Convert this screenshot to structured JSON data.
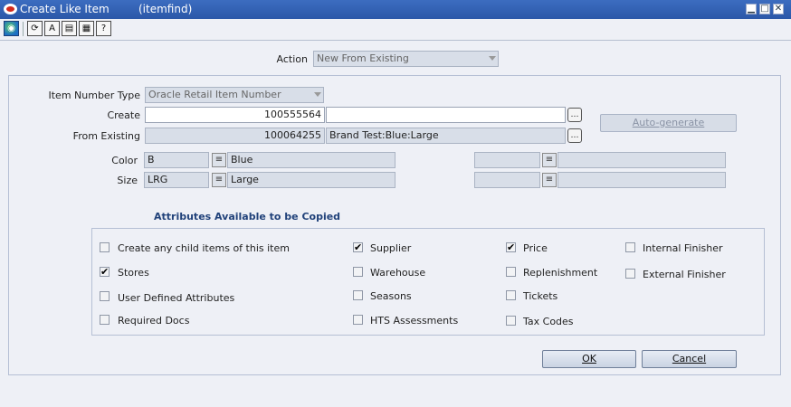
{
  "window": {
    "title": "Create Like Item",
    "subtitle": "(itemfind)",
    "minimize_icon": "▁",
    "maximize_icon": "□",
    "close_icon": "✕"
  },
  "toolbar": {
    "buttons": [
      {
        "name": "globe-icon",
        "glyph": "◉"
      },
      {
        "name": "save-icon",
        "glyph": "⟳"
      },
      {
        "name": "spellcheck-icon",
        "glyph": "A"
      },
      {
        "name": "notes-icon",
        "glyph": "▤"
      },
      {
        "name": "print-icon",
        "glyph": "▦"
      },
      {
        "name": "help-icon",
        "glyph": "?"
      }
    ]
  },
  "action": {
    "label": "Action",
    "value": "New From Existing"
  },
  "form": {
    "item_number_type_label": "Item Number Type",
    "item_number_type_value": "Oracle Retail Item Number",
    "create_label": "Create",
    "create_value": "100555564",
    "create_desc": "",
    "from_existing_label": "From Existing",
    "from_existing_value": "100064255",
    "from_existing_desc": "Brand Test:Blue:Large",
    "auto_generate_label": "Auto-generate",
    "color_label": "Color",
    "color_code": "B",
    "color_desc": "Blue",
    "size_label": "Size",
    "size_code": "LRG",
    "size_desc": "Large",
    "lov_icon": "…",
    "flex_icon": "≡"
  },
  "attributes": {
    "heading": "Attributes Available to be Copied",
    "items": [
      {
        "label": "Create any child items of this item",
        "checked": false
      },
      {
        "label": "Stores",
        "checked": true
      },
      {
        "label": "User Defined Attributes",
        "checked": false
      },
      {
        "label": "Required Docs",
        "checked": false
      },
      {
        "label": "Supplier",
        "checked": true
      },
      {
        "label": "Warehouse",
        "checked": false
      },
      {
        "label": "Seasons",
        "checked": false
      },
      {
        "label": "HTS Assessments",
        "checked": false
      },
      {
        "label": "Price",
        "checked": true
      },
      {
        "label": "Replenishment",
        "checked": false
      },
      {
        "label": "Tickets",
        "checked": false
      },
      {
        "label": "Tax Codes",
        "checked": false
      },
      {
        "label": "Internal Finisher",
        "checked": false
      },
      {
        "label": "External Finisher",
        "checked": false
      }
    ],
    "check_glyph": "✔"
  },
  "buttons": {
    "ok": "OK",
    "cancel": "Cancel"
  }
}
